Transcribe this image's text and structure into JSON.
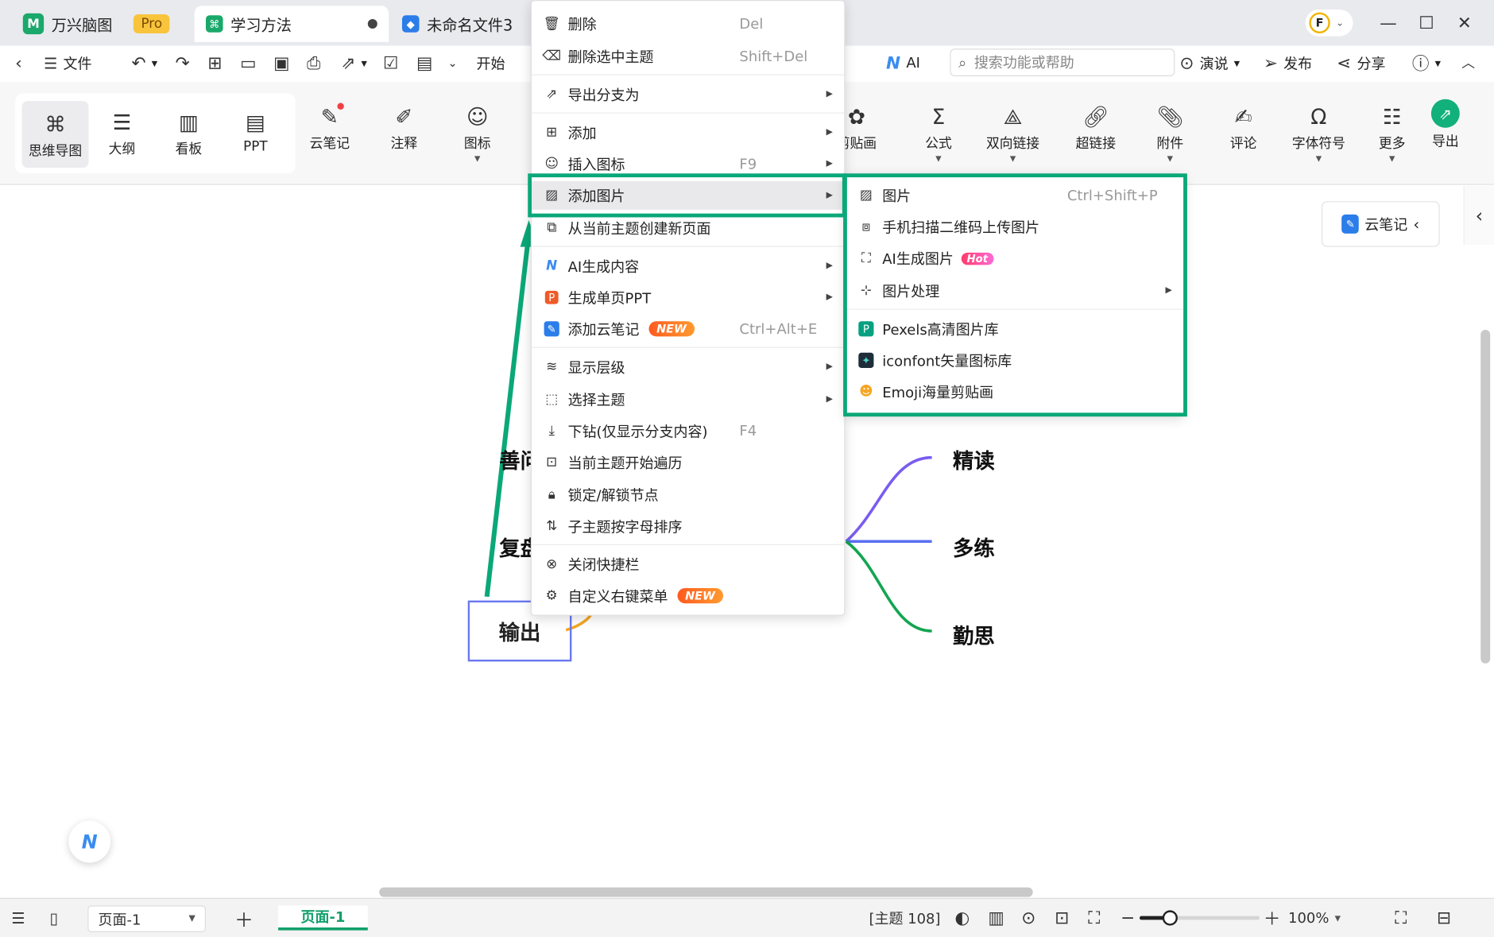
{
  "tabs": [
    {
      "label": "万兴脑图",
      "badge": "Pro"
    },
    {
      "label": "学习方法",
      "unsaved": true
    },
    {
      "label": "未命名文件3"
    }
  ],
  "user_avatar": "F",
  "menubar": {
    "file": "文件",
    "start": "开始",
    "ai": "AI",
    "search_placeholder": "搜索功能或帮助",
    "present": "演说",
    "publish": "发布",
    "share": "分享"
  },
  "ribbon": {
    "views": [
      "思维导图",
      "大纲",
      "看板",
      "PPT"
    ],
    "tools": [
      "云笔记",
      "注释",
      "图标"
    ],
    "right_tools": [
      "剪贴画",
      "公式",
      "双向链接",
      "超链接",
      "附件",
      "评论",
      "字体符号",
      "更多",
      "导出"
    ]
  },
  "context_menu": {
    "items": [
      {
        "label": "删除",
        "shortcut": "Del",
        "icon": "trash-icon"
      },
      {
        "label": "删除选中主题",
        "shortcut": "Shift+Del",
        "icon": "delete-topic-icon"
      },
      {
        "label": "导出分支为",
        "submenu": true,
        "icon": "export-icon"
      },
      {
        "label": "添加",
        "submenu": true,
        "icon": "plus-box-icon"
      },
      {
        "label": "插入图标",
        "shortcut": "F9",
        "submenu": true,
        "icon": "smile-icon"
      },
      {
        "label": "添加图片",
        "submenu": true,
        "icon": "image-icon",
        "highlighted": true
      },
      {
        "label": "从当前主题创建新页面",
        "icon": "new-page-icon"
      },
      {
        "label": "AI生成内容",
        "submenu": true,
        "icon": "ai-logo-icon"
      },
      {
        "label": "生成单页PPT",
        "submenu": true,
        "icon": "ppt-icon"
      },
      {
        "label": "添加云笔记",
        "badge": "NEW",
        "shortcut": "Ctrl+Alt+E",
        "icon": "cloud-note-icon"
      },
      {
        "label": "显示层级",
        "submenu": true,
        "icon": "layers-icon"
      },
      {
        "label": "选择主题",
        "submenu": true,
        "icon": "select-topic-icon"
      },
      {
        "label": "下钻(仅显示分支内容)",
        "shortcut": "F4",
        "icon": "drill-down-icon"
      },
      {
        "label": "当前主题开始遍历",
        "icon": "traverse-icon"
      },
      {
        "label": "锁定/解锁节点",
        "icon": "lock-icon"
      },
      {
        "label": "子主题按字母排序",
        "icon": "sort-icon"
      },
      {
        "label": "关闭快捷栏",
        "icon": "close-circle-icon"
      },
      {
        "label": "自定义右键菜单",
        "badge": "NEW",
        "icon": "settings-icon"
      }
    ]
  },
  "image_submenu": {
    "items": [
      {
        "label": "图片",
        "shortcut": "Ctrl+Shift+P"
      },
      {
        "label": "手机扫描二维码上传图片"
      },
      {
        "label": "AI生成图片",
        "badge": "Hot"
      },
      {
        "label": "图片处理",
        "submenu": true
      },
      {
        "label": "Pexels高清图片库"
      },
      {
        "label": "iconfont矢量图标库"
      },
      {
        "label": "Emoji海量剪贴画"
      }
    ]
  },
  "mindmap": {
    "left_nodes": [
      "善问",
      "复盘"
    ],
    "selected_node": "输出",
    "right_nodes": [
      "精读",
      "多练",
      "勤思"
    ]
  },
  "cloud_note_button": "云笔记",
  "statusbar": {
    "page_select": "页面-1",
    "page_tab": "页面-1",
    "topic_count": "[主题 108]",
    "zoom": "100%"
  },
  "colors": {
    "accent_green": "#0aa878",
    "node_purple": "#7a5cf0",
    "node_blue": "#5b6ef0",
    "node_green": "#12a550",
    "selection_border": "#6a78f0"
  }
}
